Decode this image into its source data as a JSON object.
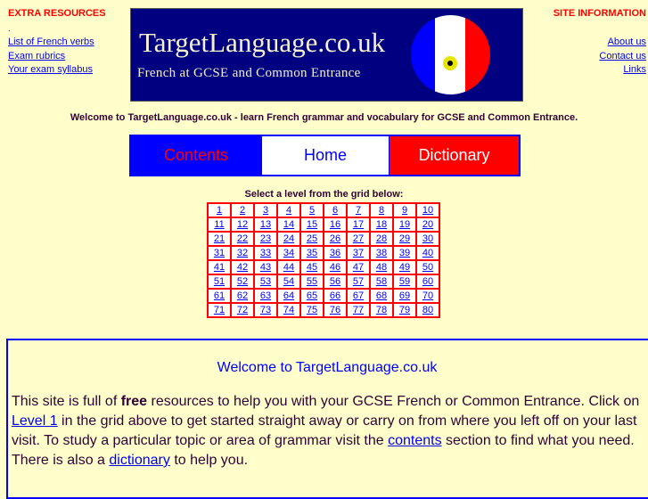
{
  "left_sidebar": {
    "heading": "EXTRA RESOURCES",
    "dot": ".",
    "links": [
      "List of French verbs",
      "Exam rubrics",
      "Your exam syllabus"
    ]
  },
  "right_sidebar": {
    "heading": "SITE INFORMATION",
    "links": [
      "About us",
      "Contact us",
      "Links"
    ]
  },
  "banner": {
    "title": "TargetLanguage.co.uk",
    "subtitle": "French at GCSE and Common Entrance",
    "colors": {
      "background": "#000080",
      "flag_blue": "#0000ff",
      "flag_white": "#ffffff",
      "flag_red": "#ff0000"
    }
  },
  "welcome_line": "Welcome to TargetLanguage.co.uk - learn French grammar and vocabulary for GCSE and Common Entrance.",
  "nav": {
    "contents": "Contents",
    "home": "Home",
    "dictionary": "Dictionary"
  },
  "grid": {
    "title": "Select a level from the grid below:",
    "levels": [
      1,
      2,
      3,
      4,
      5,
      6,
      7,
      8,
      9,
      10,
      11,
      12,
      13,
      14,
      15,
      16,
      17,
      18,
      19,
      20,
      21,
      22,
      23,
      24,
      25,
      26,
      27,
      28,
      29,
      30,
      31,
      32,
      33,
      34,
      35,
      36,
      37,
      38,
      39,
      40,
      41,
      42,
      43,
      44,
      45,
      46,
      47,
      48,
      49,
      50,
      51,
      52,
      53,
      54,
      55,
      56,
      57,
      58,
      59,
      60,
      61,
      62,
      63,
      64,
      65,
      66,
      67,
      68,
      69,
      70,
      71,
      72,
      73,
      74,
      75,
      76,
      77,
      78,
      79,
      80
    ]
  },
  "main": {
    "heading": "Welcome to TargetLanguage.co.uk",
    "p1": "This site is full of ",
    "free": "free",
    "p2": " resources to help you with your GCSE French or Common Entrance. Click on ",
    "level1_link": "Level 1",
    "p3": " in the grid above to get started straight away or carry on from where you left off on your last visit. To study a particular topic or area of grammar visit the ",
    "contents_link": "contents",
    "p4": " section to find what you need. There is also a ",
    "dictionary_link": "dictionary",
    "p5": " to help you."
  }
}
